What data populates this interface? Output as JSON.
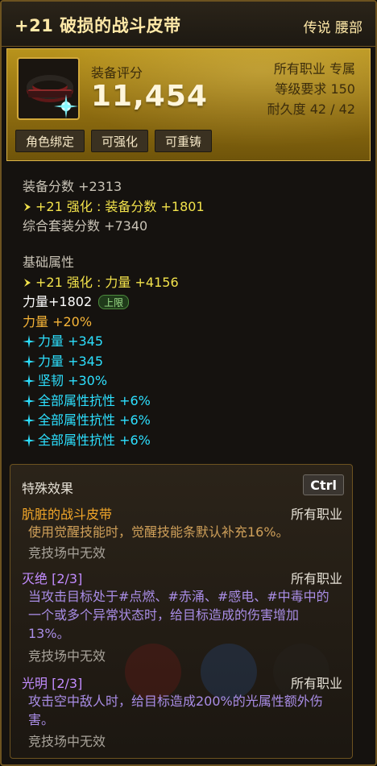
{
  "header": {
    "title": "+21 破损的战斗皮带",
    "rarity_slot": "传说 腰部"
  },
  "summary": {
    "score_label": "装备评分",
    "score_value": "11,454",
    "job": "所有职业 专属",
    "level_req": "等级要求 150",
    "durability": "耐久度 42 / 42",
    "tags": [
      "角色绑定",
      "可强化",
      "可重铸"
    ],
    "item_icon": "belt-icon"
  },
  "equip_score": {
    "base": "装备分数 +2313",
    "enhance": "+21 强化 : 装备分数 +1801",
    "set": "综合套装分数 +7340"
  },
  "base_attr": {
    "title": "基础属性",
    "enhance_line": "+21 强化 : 力量 +4156",
    "strength": "力量+1802",
    "cap_badge": "上限",
    "strength_pct": "力量 +20%",
    "bonus_lines": [
      "力量 +345",
      "力量 +345",
      "坚韧 +30%",
      "全部属性抗性 +6%",
      "全部属性抗性 +6%",
      "全部属性抗性 +6%"
    ]
  },
  "special": {
    "title": "特殊效果",
    "ctrl_hint": "Ctrl",
    "effects": [
      {
        "name": "肮脏的战斗皮带",
        "job": "所有职业",
        "desc": "使用觉醒技能时，觉醒技能条默认补充16%。",
        "note": "竞技场中无效"
      },
      {
        "name": "灭绝 [2/3]",
        "job": "所有职业",
        "desc": "当攻击目标处于#点燃、#赤涌、#感电、#中毒中的一个或多个异常状态时，给目标造成的伤害增加13%。",
        "note": "竞技场中无效"
      },
      {
        "name": "光明 [2/3]",
        "job": "所有职业",
        "desc": "攻击空中敌人时，给目标造成200%的光属性额外伤害。",
        "note": "竞技场中无效"
      }
    ]
  },
  "colors": {
    "gold": "#b8931c",
    "enhance_yellow": "#f2e24b",
    "bonus_cyan": "#2de0ff",
    "percent_orange": "#f7b538",
    "effect_purple": "#c28cff"
  }
}
